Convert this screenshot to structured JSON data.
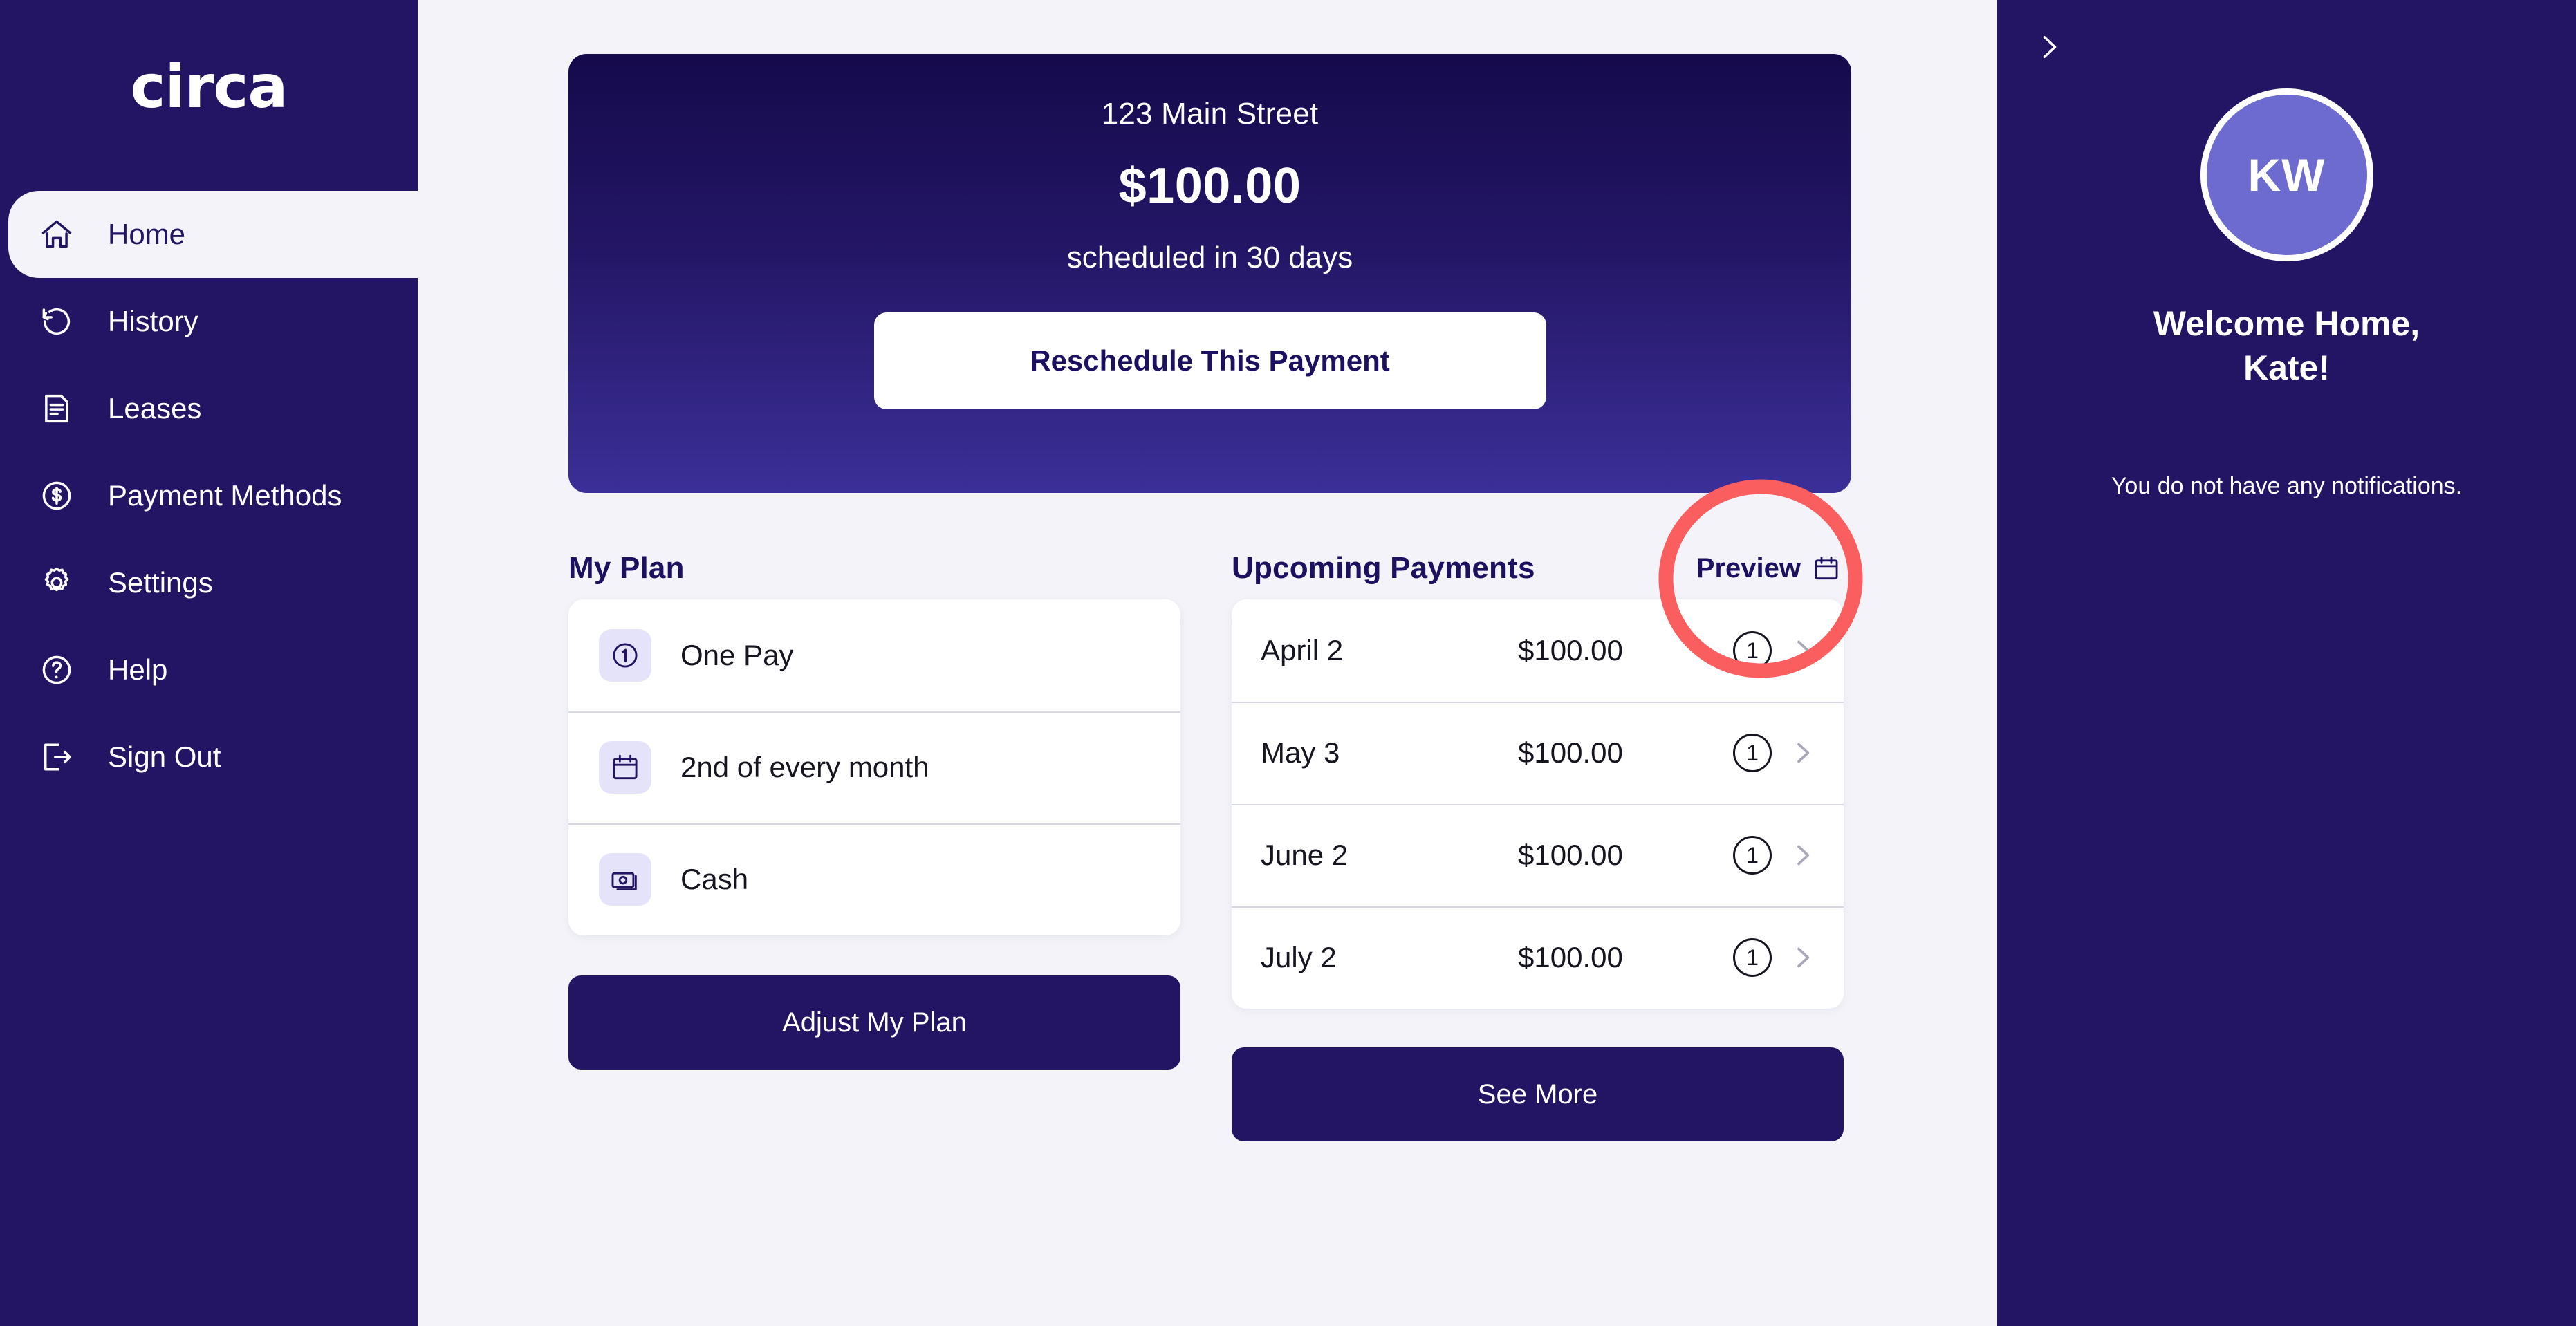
{
  "brand": {
    "logo_text": "circa",
    "navy": "#231464",
    "accent_periwinkle": "#6d6bd0",
    "page_bg": "#f3f3f9",
    "annotation_color": "#fb5e5e"
  },
  "sidebar": {
    "items": [
      {
        "label": "Home",
        "icon": "home-icon",
        "active": true
      },
      {
        "label": "History",
        "icon": "history-icon",
        "active": false
      },
      {
        "label": "Leases",
        "icon": "document-icon",
        "active": false
      },
      {
        "label": "Payment Methods",
        "icon": "dollar-circle-icon",
        "active": false
      },
      {
        "label": "Settings",
        "icon": "gear-icon",
        "active": false
      },
      {
        "label": "Help",
        "icon": "question-circle-icon",
        "active": false
      },
      {
        "label": "Sign Out",
        "icon": "logout-icon",
        "active": false
      }
    ]
  },
  "hero": {
    "address": "123 Main Street",
    "amount": "$100.00",
    "schedule_text": "scheduled in 30 days",
    "button_label": "Reschedule This Payment"
  },
  "plan": {
    "title": "My Plan",
    "rows": [
      {
        "label": "One Pay",
        "icon": "number-one-circle-icon"
      },
      {
        "label": "2nd of every month",
        "icon": "calendar-icon"
      },
      {
        "label": "Cash",
        "icon": "cash-icon"
      }
    ],
    "button_label": "Adjust My Plan"
  },
  "payments": {
    "title": "Upcoming Payments",
    "preview_label": "Preview",
    "preview_icon": "calendar-icon",
    "rows": [
      {
        "date": "April 2",
        "amount": "$100.00",
        "count": "1"
      },
      {
        "date": "May 3",
        "amount": "$100.00",
        "count": "1"
      },
      {
        "date": "June 2",
        "amount": "$100.00",
        "count": "1"
      },
      {
        "date": "July 2",
        "amount": "$100.00",
        "count": "1"
      }
    ],
    "button_label": "See More"
  },
  "right_panel": {
    "collapse_icon": "chevron-right-icon",
    "avatar_initials": "KW",
    "welcome_line1": "Welcome Home,",
    "welcome_line2": "Kate!",
    "notifications_empty": "You do not have any notifications."
  }
}
